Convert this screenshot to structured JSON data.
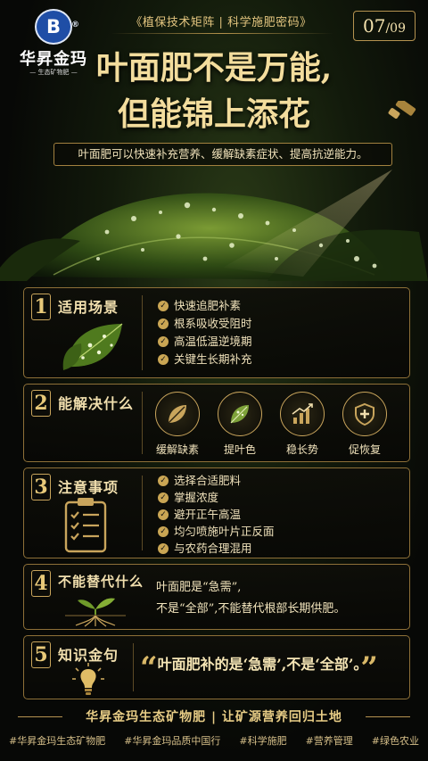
{
  "brand": {
    "logo_letter": "B",
    "registered": "®",
    "name": "华昇金玛",
    "tagline": "— 生态矿物肥 —"
  },
  "header": {
    "series_tag": "《植保技术矩阵 | 科学施肥密码》",
    "page_current": "07",
    "page_total": "/09"
  },
  "title": {
    "line1": "叶面肥不是万能,",
    "line2": "但能锦上添花"
  },
  "subtitle": "叶面肥可以快速补充营养、缓解缺素症状、提高抗逆能力。",
  "sections": [
    {
      "num": "1",
      "title": "适用场景",
      "icon": "leaf-icon",
      "items": [
        "快速追肥补素",
        "根系吸收受阻时",
        "高温低温逆境期",
        "关键生长期补充"
      ]
    },
    {
      "num": "2",
      "title": "能解决什么",
      "benefits": [
        {
          "label": "缓解缺素",
          "icon": "leaf-icon"
        },
        {
          "label": "提叶色",
          "icon": "green-leaf-icon"
        },
        {
          "label": "稳长势",
          "icon": "growth-chart-icon"
        },
        {
          "label": "促恢复",
          "icon": "shield-plus-icon"
        }
      ]
    },
    {
      "num": "3",
      "title": "注意事项",
      "icon": "checklist-clipboard-icon",
      "items": [
        "选择合适肥料",
        "掌握浓度",
        "避开正午高温",
        "均匀喷施叶片正反面",
        "与农药合理混用"
      ]
    },
    {
      "num": "4",
      "title": "不能替代什么",
      "icon": "sprout-roots-icon",
      "line1": "叶面肥是“急需”,",
      "line2": "不是“全部”,不能替代根部长期供肥。"
    },
    {
      "num": "5",
      "title": "知识金句",
      "icon": "lightbulb-icon",
      "quote": "叶面肥补的是‘急需’,不是‘全部’。"
    }
  ],
  "footer": {
    "slogan": "华昇金玛生态矿物肥 | 让矿源营养回归土地",
    "tags": [
      "#华昇金玛生态矿物肥",
      "#华昇金玛品质中国行",
      "#科学施肥",
      "#营养管理",
      "#绿色农业"
    ]
  },
  "colors": {
    "gold": "#e3c57f",
    "border_gold": "#8e7038",
    "background": "#070806",
    "logo_blue": "#1f4ea6"
  }
}
